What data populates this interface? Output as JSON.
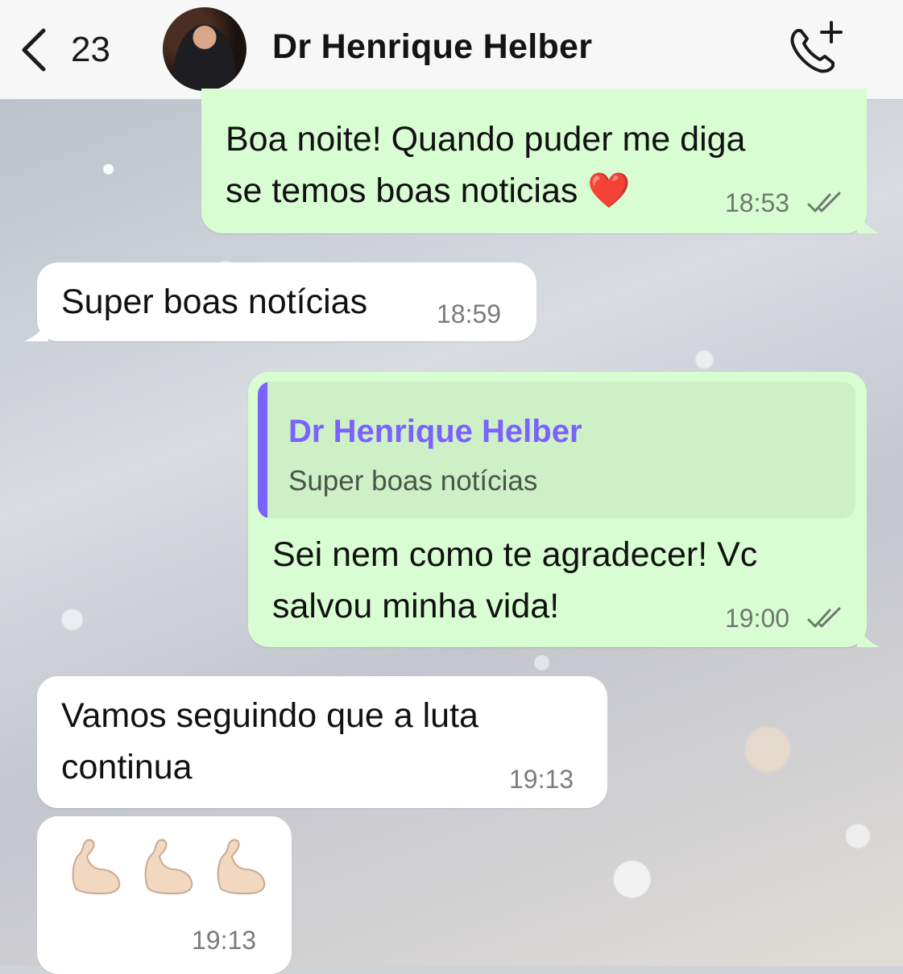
{
  "header": {
    "back_count": "23",
    "contact_name": "Dr Henrique Helber",
    "icons": {
      "back": "chevron-left-icon",
      "call": "phone-add-icon"
    }
  },
  "messages": [
    {
      "direction": "out",
      "line1": "Boa noite! Quando puder me diga",
      "line2": "se temos boas noticias ❤️",
      "time": "18:53",
      "status": "read"
    },
    {
      "direction": "in",
      "line1": "Super boas notícias",
      "time": "18:59"
    },
    {
      "direction": "out",
      "reply_author": "Dr Henrique Helber",
      "reply_text": "Super boas notícias",
      "line1": "Sei nem como te agradecer! Vc",
      "line2": "salvou minha vida!",
      "time": "19:00",
      "status": "read"
    },
    {
      "direction": "in",
      "line1": "Vamos seguindo que a luta",
      "line2": "continua",
      "time": "19:13"
    },
    {
      "direction": "in",
      "emoji": "💪🏻💪🏻💪🏻",
      "time": "19:13"
    }
  ],
  "colors": {
    "outgoing_bubble": "#d9fdd3",
    "incoming_bubble": "#ffffff",
    "reply_accent": "#7b61ff",
    "header_bg": "#f6f7f6"
  }
}
